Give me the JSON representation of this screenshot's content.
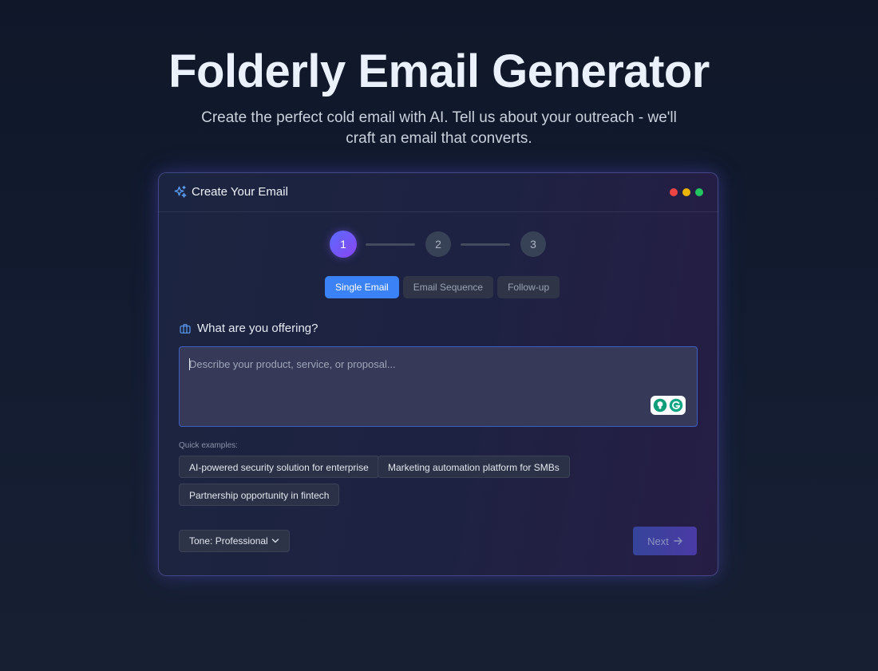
{
  "hero": {
    "title": "Folderly Email Generator",
    "subtitle": "Create the perfect cold email with AI. Tell us about your outreach - we'll craft an email that converts."
  },
  "card": {
    "title": "Create Your Email",
    "icon": "sparkles-icon",
    "window_dots": [
      "#ef4444",
      "#eab308",
      "#22c55e"
    ]
  },
  "stepper": {
    "current_step": 1,
    "steps": [
      "1",
      "2",
      "3"
    ]
  },
  "mode_tabs": {
    "items": [
      "Single Email",
      "Email Sequence",
      "Follow-up"
    ],
    "selected": "Single Email"
  },
  "offer": {
    "label": "What are you offering?",
    "icon": "briefcase-icon",
    "value": "",
    "placeholder": "Describe your product, service, or proposal..."
  },
  "quick_examples": {
    "label": "Quick examples:",
    "items": [
      "AI-powered security solution for enterprise",
      "Marketing automation platform for SMBs",
      "Partnership opportunity in fintech"
    ]
  },
  "footer": {
    "tone_label": "Tone: Professional",
    "next_label": "Next"
  },
  "colors": {
    "accent": "#3b82f6",
    "step_gradient_start": "#5a6bff",
    "step_gradient_end": "#8a45f0",
    "card_border": "#5a63b8"
  }
}
